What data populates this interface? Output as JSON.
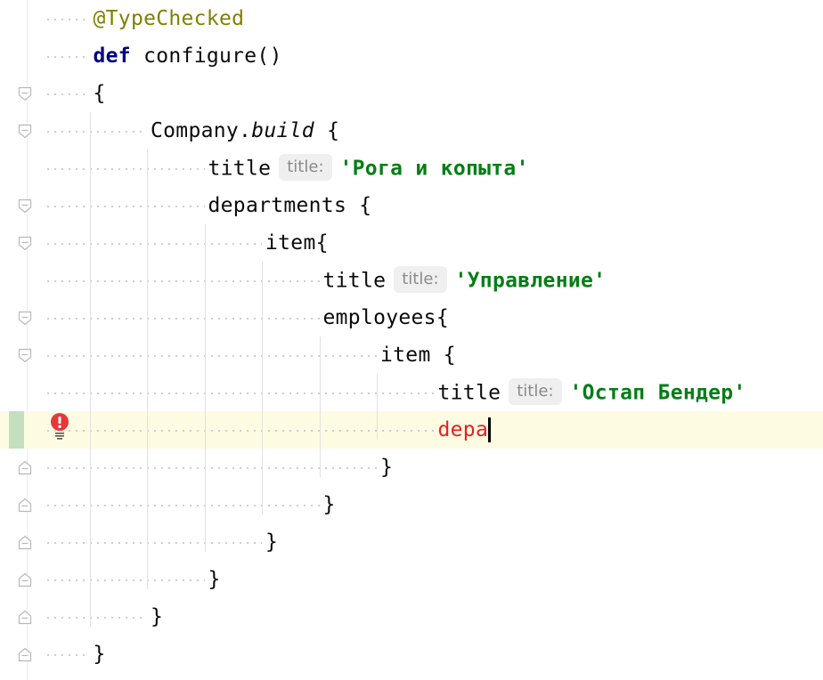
{
  "editor": {
    "lines": [
      {
        "indent": 1,
        "fold": "none",
        "tokens": [
          {
            "t": "@TypeChecked",
            "c": "anno"
          }
        ]
      },
      {
        "indent": 1,
        "fold": "none",
        "tokens": [
          {
            "t": "def",
            "c": "kw"
          },
          {
            "t": " configure()",
            "c": ""
          }
        ]
      },
      {
        "indent": 1,
        "fold": "open",
        "tokens": [
          {
            "t": "{",
            "c": ""
          }
        ]
      },
      {
        "indent": 2,
        "fold": "open",
        "tokens": [
          {
            "t": "Company.",
            "c": ""
          },
          {
            "t": "build",
            "c": "italic"
          },
          {
            "t": " {",
            "c": ""
          }
        ]
      },
      {
        "indent": 3,
        "fold": "none",
        "tokens": [
          {
            "t": "title",
            "c": ""
          },
          {
            "hint": "title:"
          },
          {
            "t": "'Рога и копыта'",
            "c": "str"
          }
        ]
      },
      {
        "indent": 3,
        "fold": "open",
        "tokens": [
          {
            "t": "departments {",
            "c": ""
          }
        ]
      },
      {
        "indent": 4,
        "fold": "open",
        "tokens": [
          {
            "t": "item{",
            "c": ""
          }
        ]
      },
      {
        "indent": 5,
        "fold": "none",
        "tokens": [
          {
            "t": "title",
            "c": ""
          },
          {
            "hint": "title:"
          },
          {
            "t": "'Управление'",
            "c": "str"
          }
        ]
      },
      {
        "indent": 5,
        "fold": "open",
        "tokens": [
          {
            "t": "employees{",
            "c": ""
          }
        ]
      },
      {
        "indent": 6,
        "fold": "open",
        "tokens": [
          {
            "t": "item {",
            "c": ""
          }
        ]
      },
      {
        "indent": 7,
        "fold": "none",
        "tokens": [
          {
            "t": "title",
            "c": ""
          },
          {
            "hint": "title:"
          },
          {
            "t": "'Остап Бендер'",
            "c": "str"
          }
        ]
      },
      {
        "indent": 7,
        "fold": "none",
        "current": true,
        "modified": true,
        "error": true,
        "tokens": [
          {
            "t": "depa",
            "c": "err"
          },
          {
            "caret": true
          }
        ]
      },
      {
        "indent": 6,
        "fold": "close",
        "tokens": [
          {
            "t": "}",
            "c": ""
          }
        ]
      },
      {
        "indent": 5,
        "fold": "close",
        "tokens": [
          {
            "t": "}",
            "c": ""
          }
        ]
      },
      {
        "indent": 4,
        "fold": "close",
        "tokens": [
          {
            "t": "}",
            "c": ""
          }
        ]
      },
      {
        "indent": 3,
        "fold": "close",
        "tokens": [
          {
            "t": "}",
            "c": ""
          }
        ]
      },
      {
        "indent": 2,
        "fold": "close",
        "tokens": [
          {
            "t": "}",
            "c": ""
          }
        ]
      },
      {
        "indent": 1,
        "fold": "close",
        "tokens": [
          {
            "t": "}",
            "c": ""
          }
        ]
      }
    ],
    "guides": [
      {
        "level": 1,
        "from_line": 3,
        "to_line": 17
      },
      {
        "level": 2,
        "from_line": 4,
        "to_line": 16
      },
      {
        "level": 3,
        "from_line": 6,
        "to_line": 15
      },
      {
        "level": 4,
        "from_line": 7,
        "to_line": 14
      },
      {
        "level": 5,
        "from_line": 9,
        "to_line": 13
      },
      {
        "level": 6,
        "from_line": 10,
        "to_line": 12
      }
    ],
    "error_icon": "error-exclamation-icon",
    "colors": {
      "annotation": "#808000",
      "keyword": "#000080",
      "string": "#067d17",
      "error_text": "#e51f1f",
      "current_line": "#fdfce2",
      "vcs_modified": "#c4dfc0",
      "hint_bg": "#efefef",
      "hint_text": "#8a8a8a"
    }
  }
}
